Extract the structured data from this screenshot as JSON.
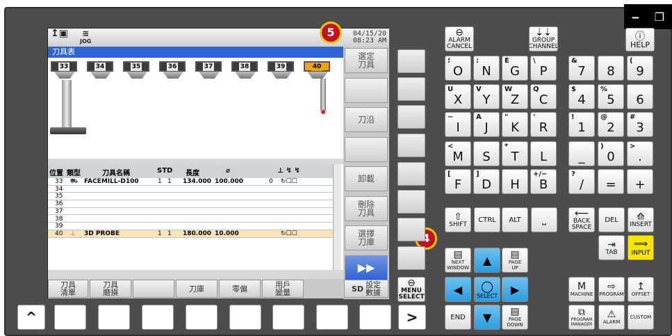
{
  "window_controls": {
    "minimize": "‒",
    "restore": "❐"
  },
  "screen": {
    "mode": "JOG",
    "date": "04/15/20",
    "time": "08:23 AM",
    "title": "刀具表",
    "holders": [
      "33",
      "34",
      "35",
      "36",
      "37",
      "38",
      "39",
      "40"
    ],
    "active_holder": "40",
    "softkeys_right": [
      "選定\n刀具",
      "",
      "刀沿",
      "",
      "卸載",
      "刪除\n刀具",
      "選擇\n刀庫",
      "▶▶"
    ],
    "table_headers": [
      "位置",
      "類型",
      "刀具名稱",
      "STD",
      "長度",
      "⌀"
    ],
    "rows": [
      {
        "pos": "33",
        "type": "mill",
        "name": "FACEMILL-D100",
        "st": "1",
        "d": "1",
        "len": "134.000",
        "dia": "100.000",
        "extra": "0"
      },
      {
        "pos": "34"
      },
      {
        "pos": "35"
      },
      {
        "pos": "36"
      },
      {
        "pos": "37"
      },
      {
        "pos": "38"
      },
      {
        "pos": "39"
      },
      {
        "pos": "40",
        "type": "probe",
        "name": "3D PROBE",
        "st": "1",
        "d": "1",
        "len": "180.000",
        "dia": "10.000",
        "extra": ""
      }
    ],
    "bottom_keys": [
      "刀具\n清單",
      "刀具\n磨損",
      "刀庫",
      "零偏",
      "用戶\n變量",
      "設定\n數據"
    ],
    "bottom_prefix": "SD"
  },
  "badges": {
    "five": "5",
    "four": "4"
  },
  "side": {
    "up_label": "^",
    "menu_select": "MENU\nSELECT",
    "next": ">"
  },
  "keys": {
    "alarm_cancel": "ALARM\nCANCEL",
    "group_channel": "GROUP\nCHANNEL",
    "help": "HELP",
    "letters_row1": [
      [
        "؛",
        "O"
      ],
      [
        ":",
        "N"
      ],
      [
        "E",
        "G"
      ],
      [
        "\\",
        "P"
      ]
    ],
    "letters_row2": [
      [
        "U",
        "X"
      ],
      [
        "V",
        "Y"
      ],
      [
        "W",
        "Z"
      ],
      [
        "Q",
        "C"
      ]
    ],
    "letters_row3": [
      [
        "−",
        "I"
      ],
      [
        "A",
        "J"
      ],
      [
        "\"",
        "K"
      ],
      [
        "'",
        "R"
      ]
    ],
    "letters_row4": [
      [
        "<",
        "M"
      ],
      [
        "",
        "S"
      ],
      [
        "*",
        "T"
      ],
      [
        "",
        "L"
      ]
    ],
    "letters_row5": [
      [
        "[",
        "F"
      ],
      [
        "]",
        "D"
      ],
      [
        "",
        "H"
      ],
      [
        "+/−",
        "B"
      ]
    ],
    "numbers_row1": [
      [
        "&",
        "7"
      ],
      [
        "",
        "8"
      ],
      [
        "(",
        "9"
      ]
    ],
    "numbers_row2": [
      [
        "$",
        "4"
      ],
      [
        "%",
        "5"
      ],
      [
        "",
        "6"
      ]
    ],
    "numbers_row3": [
      [
        "!",
        "1"
      ],
      [
        "@",
        "2"
      ],
      [
        "#",
        "3"
      ]
    ],
    "numbers_row4": [
      [
        "",
        "_"
      ],
      [
        ")",
        "0"
      ],
      [
        ">",
        "."
      ]
    ],
    "numbers_row5": [
      [
        "?",
        "/"
      ],
      [
        "",
        "="
      ],
      [
        "",
        "+"
      ]
    ],
    "shift": "SHIFT",
    "ctrl": "CTRL",
    "alt": "ALT",
    "space": "⎵",
    "backspace": "BACK\nSPACE",
    "del": "DEL",
    "insert": "INSERT",
    "tab": "TAB",
    "input": "INPUT",
    "next_window": "NEXT\nWINDOW",
    "page_up": "PAGE\nUP",
    "page_down": "PAGE\nDOWN",
    "select": "SELECT",
    "end": "END",
    "machine": "MACHINE",
    "program": "PROGRAM",
    "offset": "OFFSET",
    "program_manager": "PROGRAM\nMANAGER",
    "alarm": "ALARM",
    "custom": "CUSTOM"
  }
}
